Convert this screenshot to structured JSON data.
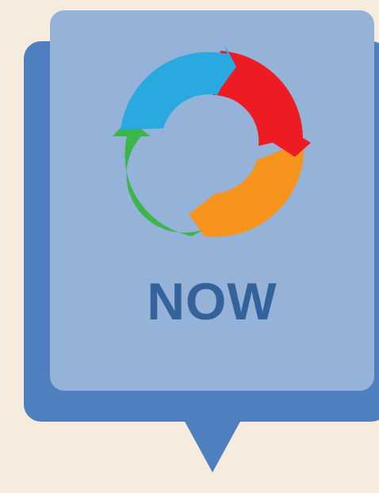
{
  "card": {
    "caption": "NOW",
    "icon": "cycle-arrows-icon"
  },
  "colors": {
    "background": "#f6ecde",
    "back_panel": "#4f7fbe",
    "front_panel": "#95b3d8",
    "caption_text": "#34629a",
    "arrow_blue": "#2aa9e0",
    "arrow_red": "#ed1c24",
    "arrow_orange": "#f7941d",
    "arrow_green": "#3cb54a"
  }
}
